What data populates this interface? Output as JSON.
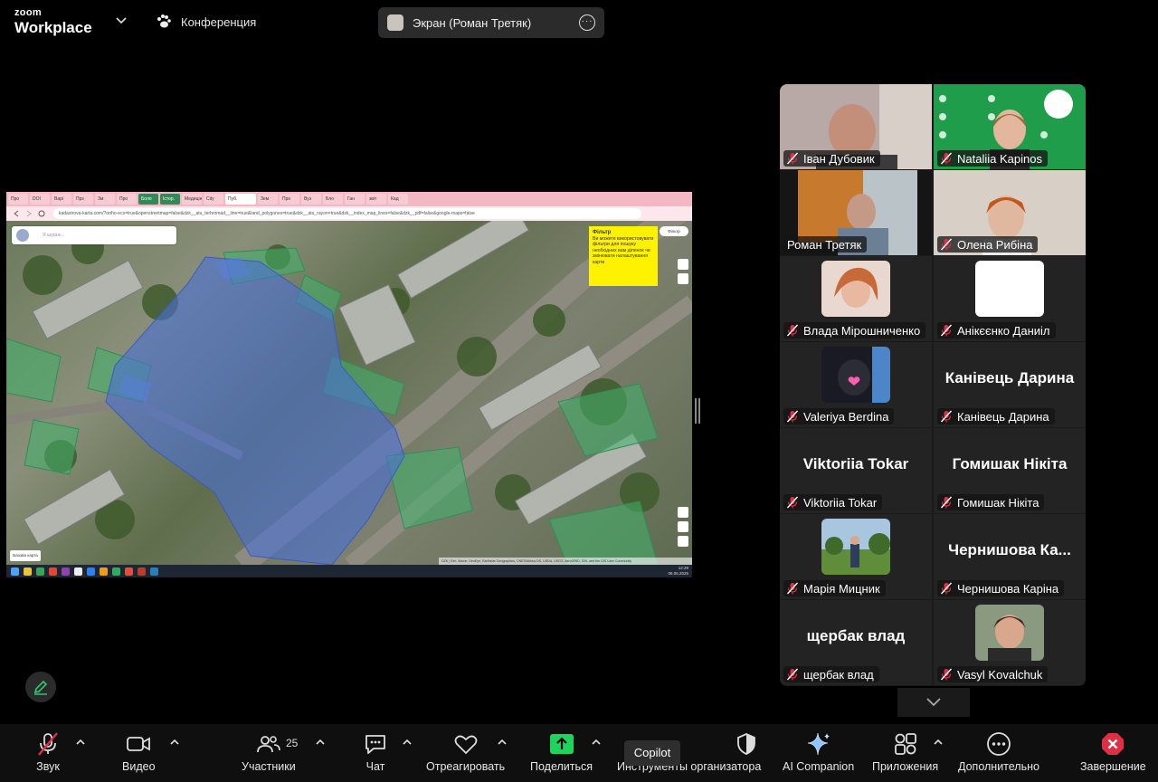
{
  "app": {
    "logo_line1": "zoom",
    "logo_line2": "Workplace",
    "meeting_label": "Конференция",
    "screen_share_label": "Экран (Роман Третяк)"
  },
  "colors": {
    "active_speaker": "#2ecc71",
    "share_button": "#1fd45c",
    "end_button": "#e02f44",
    "muted_mic": "#e02f44",
    "tooltip_yellow": "#fff200"
  },
  "shared_screen": {
    "url": "kadastrova-karta.com/?ortho-ecs=true&openstreetmap=false&dzk__atu_terhromad__line=true&land_polygones=true&dzk__atu_rayon=true&dzk__index_map_lines=false&dzk__pdf=false&google-maps=false",
    "tabs": [
      "Про",
      "DOI",
      "Варі",
      "Прз",
      "Зм",
      "Про",
      "Боло",
      "Істор. Креа",
      "Медицін",
      "City",
      "Пуб.",
      "Зем",
      "Про",
      "Вуз",
      "Бло",
      "Ган",
      "звіт",
      "Кад"
    ],
    "search_placeholder": "Я шукаю...",
    "filter_button": "Фільтр",
    "filter_tip_title": "Фільтр",
    "filter_tip_text": "Ви можете використовувати фільтри для пошуку необхідних вам ділянок чи змінювати налаштування карти",
    "basemap_button": "Базова карта",
    "attribution": "DZK | Esri, Maxar, GeoEye, Earthstar Geographics, CNES/Airbus DS, USDA, USGS, AeroGRID, IGN, and the GIS User Community",
    "clock_time": "12:29",
    "clock_date": "06.05.2025"
  },
  "participants": [
    {
      "name": "Іван Дубовик",
      "type": "video",
      "muted": true
    },
    {
      "name": "Nataliia Kapinos",
      "type": "video",
      "muted": true
    },
    {
      "name": "Роман Третяк",
      "type": "video",
      "muted": false,
      "speaking": true
    },
    {
      "name": "Олена Рибіна",
      "type": "video",
      "muted": true
    },
    {
      "name": "Влада Мірошниченко",
      "type": "avatar",
      "muted": true
    },
    {
      "name": "Анікєєнко Даниіл",
      "type": "avatar",
      "muted": true
    },
    {
      "name": "Valeriya Berdina",
      "type": "avatar",
      "muted": true
    },
    {
      "name": "Канівець Дарина",
      "type": "text",
      "big_name": "Канівець Дарина",
      "muted": true
    },
    {
      "name": "Viktoriia Tokar",
      "type": "text",
      "big_name": "Viktoriia Tokar",
      "muted": true
    },
    {
      "name": "Гомишак Нікіта",
      "type": "text",
      "big_name": "Гомишак Нікіта",
      "muted": true
    },
    {
      "name": "Марія Мицник",
      "type": "avatar",
      "muted": true
    },
    {
      "name": "Чернишова Каріна",
      "type": "text",
      "big_name": "Чернишова  Ка...",
      "muted": true
    },
    {
      "name": "щербак влад",
      "type": "text",
      "big_name": "щербак влад",
      "muted": true
    },
    {
      "name": "Vasyl Kovalchuk",
      "type": "avatar",
      "muted": true
    }
  ],
  "toolbar": {
    "audio": "Звук",
    "video": "Видео",
    "participants": "Участники",
    "participants_count": "25",
    "chat": "Чат",
    "react": "Отреагировать",
    "share": "Поделиться",
    "host_tools": "Инструменты организатора",
    "ai_companion": "AI Companion",
    "apps": "Приложения",
    "more": "Дополнительно",
    "end": "Завершение",
    "copilot_tooltip": "Copilot"
  }
}
